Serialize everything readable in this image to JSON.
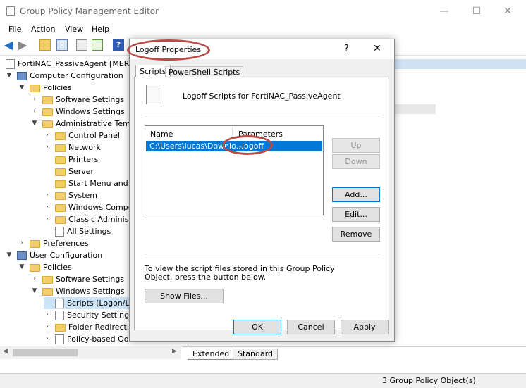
{
  "window": {
    "title": "Group Policy Management Editor",
    "minimize": "—",
    "maximize": "☐",
    "close": "✕"
  },
  "menu": [
    "File",
    "Action",
    "View",
    "Help"
  ],
  "tree": [
    {
      "label": "FortiNAC_PassiveAgent [MERCE",
      "arrow": ""
    },
    {
      "label": "Computer Configuration",
      "arrow": "▼"
    },
    {
      "label": "Policies",
      "arrow": "▼"
    },
    {
      "label": "Software Settings",
      "arrow": "›"
    },
    {
      "label": "Windows Settings",
      "arrow": "›"
    },
    {
      "label": "Administrative Temp",
      "arrow": "▼"
    },
    {
      "label": "Control Panel",
      "arrow": "›"
    },
    {
      "label": "Network",
      "arrow": "›"
    },
    {
      "label": "Printers",
      "arrow": ""
    },
    {
      "label": "Server",
      "arrow": ""
    },
    {
      "label": "Start Menu and T",
      "arrow": ""
    },
    {
      "label": "System",
      "arrow": "›"
    },
    {
      "label": "Windows Compo",
      "arrow": "›"
    },
    {
      "label": "Classic Administ",
      "arrow": "›"
    },
    {
      "label": "All Settings",
      "arrow": ""
    },
    {
      "label": "Preferences",
      "arrow": "›"
    },
    {
      "label": "User Configuration",
      "arrow": "▼"
    },
    {
      "label": "Policies",
      "arrow": "▼"
    },
    {
      "label": "Software Settings",
      "arrow": "›"
    },
    {
      "label": "Windows Settings",
      "arrow": "▼"
    },
    {
      "label": "Scripts (Logon/Lo",
      "arrow": ""
    },
    {
      "label": "Security Settings",
      "arrow": "›"
    },
    {
      "label": "Folder Redirectio",
      "arrow": "›"
    },
    {
      "label": "Policy-based QoS",
      "arrow": "›"
    }
  ],
  "tabs": [
    "Extended",
    "Standard"
  ],
  "status": "3 Group Policy Object(s)",
  "dialog": {
    "title": "Logoff Properties",
    "help": "?",
    "close": "✕",
    "tabs": [
      "Scripts",
      "PowerShell Scripts"
    ],
    "heading": "Logoff Scripts for FortiNAC_PassiveAgent",
    "columns": [
      "Name",
      "Parameters"
    ],
    "row": {
      "name": "C:\\Users\\lucas\\Downlo...",
      "params": "-logoff"
    },
    "side_buttons": {
      "up": "Up",
      "down": "Down",
      "add": "Add...",
      "edit": "Edit...",
      "remove": "Remove"
    },
    "info": "To view the script files stored in this Group Policy Object, press the button below.",
    "show_files": "Show Files...",
    "ok": "OK",
    "cancel": "Cancel",
    "apply": "Apply"
  },
  "colors": {
    "selection": "#0078d7",
    "annotation": "#b84a48"
  }
}
